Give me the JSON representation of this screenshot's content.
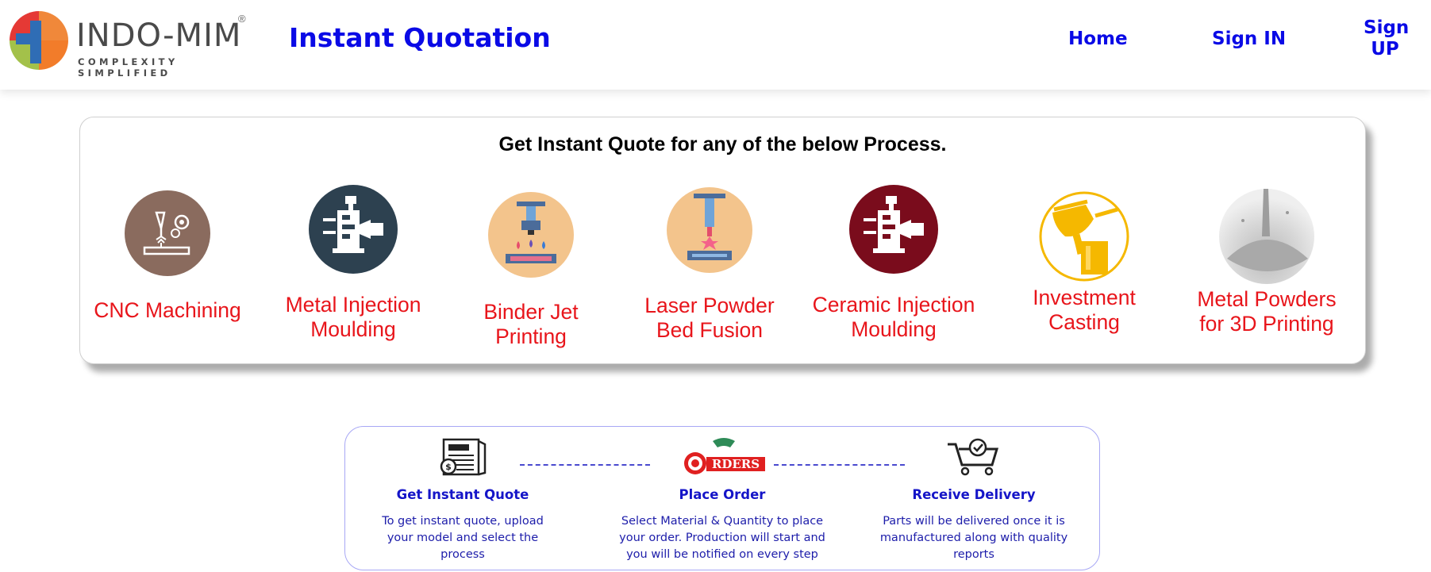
{
  "header": {
    "logo_text": "INDO-MIM",
    "logo_reg": "®",
    "logo_tagline": "COMPLEXITY SIMPLIFIED",
    "title": "Instant Quotation",
    "nav": {
      "home": "Home",
      "sign_in": "Sign IN",
      "sign_up_line1": "Sign",
      "sign_up_line2": "UP"
    }
  },
  "process_card": {
    "heading": "Get Instant Quote for any of the below Process.",
    "processes": [
      {
        "line1": "CNC Machining",
        "line2": "",
        "icon": "cnc-machining-icon"
      },
      {
        "line1": "Metal Injection",
        "line2": "Moulding",
        "icon": "metal-injection-moulding-icon"
      },
      {
        "line1": "Binder Jet",
        "line2": "Printing",
        "icon": "binder-jet-printing-icon"
      },
      {
        "line1": "Laser Powder",
        "line2": "Bed Fusion",
        "icon": "laser-powder-bed-fusion-icon"
      },
      {
        "line1": "Ceramic Injection",
        "line2": "Moulding",
        "icon": "ceramic-injection-moulding-icon"
      },
      {
        "line1": "Investment",
        "line2": "Casting",
        "icon": "investment-casting-icon"
      },
      {
        "line1": "Metal Powders",
        "line2": "for 3D Printing",
        "icon": "metal-powders-icon"
      }
    ]
  },
  "steps": [
    {
      "title": "Get Instant Quote",
      "desc1": "To get instant quote, upload",
      "desc2": "your model and select the",
      "desc3": "process",
      "icon": "quote-document-icon"
    },
    {
      "title": "Place Order",
      "desc1": "Select Material & Quantity to place",
      "desc2": "your order. Production will start and",
      "desc3": "you will be notified on every step",
      "icon": "orders-icon",
      "icon_text": "RDERS"
    },
    {
      "title": "Receive Delivery",
      "desc1": "Parts will be delivered once it is",
      "desc2": "manufactured along with quality",
      "desc3": "reports",
      "icon": "shopping-cart-icon"
    }
  ],
  "colors": {
    "brand_blue": "#0a0ae6",
    "process_red": "#e8151b",
    "step_blue": "#1515c8"
  }
}
